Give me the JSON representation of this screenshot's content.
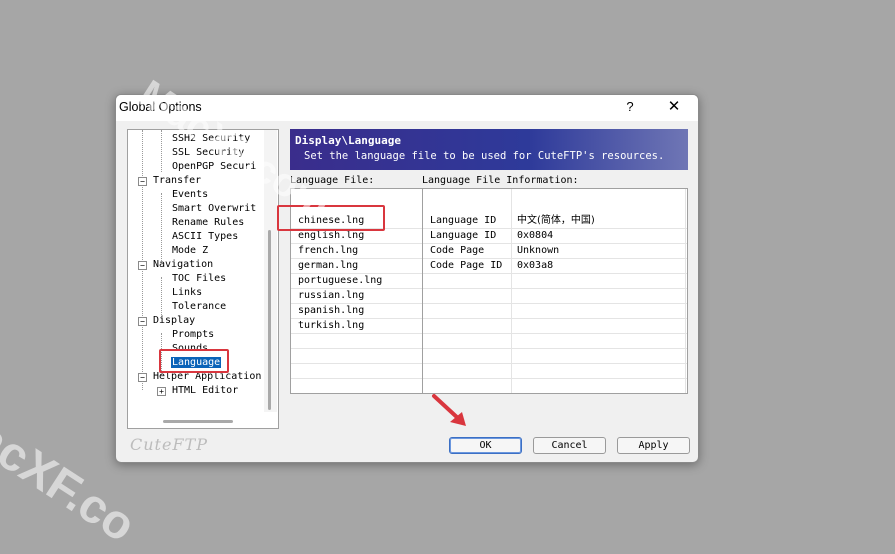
{
  "window": {
    "title": "Global Options",
    "help_label": "?",
    "close_label": "✕"
  },
  "tree": {
    "items": [
      {
        "label": "SSH2 Security",
        "expander": ""
      },
      {
        "label": "SSL Security",
        "expander": ""
      },
      {
        "label": "OpenPGP Securi",
        "expander": ""
      },
      {
        "label": "Transfer",
        "expander": "−"
      },
      {
        "label": "Events",
        "expander": ""
      },
      {
        "label": "Smart Overwrit",
        "expander": ""
      },
      {
        "label": "Rename Rules",
        "expander": ""
      },
      {
        "label": "ASCII Types",
        "expander": ""
      },
      {
        "label": "Mode Z",
        "expander": ""
      },
      {
        "label": "Navigation",
        "expander": "−"
      },
      {
        "label": "TOC Files",
        "expander": ""
      },
      {
        "label": "Links",
        "expander": ""
      },
      {
        "label": "Tolerance",
        "expander": ""
      },
      {
        "label": "Display",
        "expander": "−"
      },
      {
        "label": "Prompts",
        "expander": ""
      },
      {
        "label": "Sounds",
        "expander": ""
      },
      {
        "label": "Language",
        "expander": "",
        "selected": true
      },
      {
        "label": "Helper Application",
        "expander": "−"
      },
      {
        "label": "HTML Editor",
        "expander": "+"
      }
    ]
  },
  "banner": {
    "title": "Display\\Language",
    "subtitle": "Set the language file to be used for CuteFTP's resources."
  },
  "language_file": {
    "label": "Language File:",
    "files": [
      "chinese.lng",
      "english.lng",
      "french.lng",
      "german.lng",
      "portuguese.lng",
      "russian.lng",
      "spanish.lng",
      "turkish.lng"
    ]
  },
  "info": {
    "label": "Language File Information:",
    "rows": [
      {
        "key": "Language ID",
        "value": "中文(简体，中国)"
      },
      {
        "key": "Language ID",
        "value": "0x0804"
      },
      {
        "key": "Code Page",
        "value": "Unknown"
      },
      {
        "key": "Code Page ID",
        "value": "0x03a8"
      }
    ]
  },
  "buttons": {
    "ok": "OK",
    "cancel": "Cancel",
    "apply": "Apply"
  },
  "logo": "CuteFTP",
  "watermark": {
    "text1": "MacXF.com",
    "text2": "acXF.co"
  },
  "colors": {
    "selection": "#0a63b8",
    "highlight_box": "#d9363e",
    "banner": "#2e3a9a"
  }
}
